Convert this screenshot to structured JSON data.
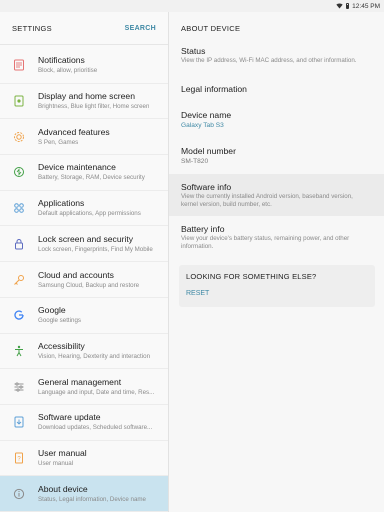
{
  "status_bar": {
    "time": "12:45 PM",
    "icons": [
      "wifi-icon",
      "battery-icon"
    ]
  },
  "left": {
    "header": {
      "title": "SETTINGS",
      "search_label": "SEARCH"
    },
    "items": [
      {
        "icon": "notifications-icon",
        "title": "Notifications",
        "subtitle": "Block, allow, prioritise",
        "color": "#e57373"
      },
      {
        "icon": "display-icon",
        "title": "Display and home screen",
        "subtitle": "Brightness, Blue light filter, Home screen",
        "color": "#7cb342"
      },
      {
        "icon": "advanced-features-icon",
        "title": "Advanced features",
        "subtitle": "S Pen, Games",
        "color": "#f0a24a"
      },
      {
        "icon": "device-maintenance-icon",
        "title": "Device maintenance",
        "subtitle": "Battery, Storage, RAM, Device security",
        "color": "#43a047"
      },
      {
        "icon": "applications-icon",
        "title": "Applications",
        "subtitle": "Default applications, App permissions",
        "color": "#5c9fd6"
      },
      {
        "icon": "lock-screen-icon",
        "title": "Lock screen and security",
        "subtitle": "Lock screen, Fingerprints, Find My Mobile",
        "color": "#5c6bc0"
      },
      {
        "icon": "cloud-accounts-icon",
        "title": "Cloud and accounts",
        "subtitle": "Samsung Cloud, Backup and restore",
        "color": "#f0a24a"
      },
      {
        "icon": "google-icon",
        "title": "Google",
        "subtitle": "Google settings",
        "color": "#4285f4"
      },
      {
        "icon": "accessibility-icon",
        "title": "Accessibility",
        "subtitle": "Vision, Hearing, Dexterity and interaction",
        "color": "#43a047"
      },
      {
        "icon": "general-management-icon",
        "title": "General management",
        "subtitle": "Language and input, Date and time, Res...",
        "color": "#8a8a8a"
      },
      {
        "icon": "software-update-icon",
        "title": "Software update",
        "subtitle": "Download updates, Scheduled software...",
        "color": "#5c9fd6"
      },
      {
        "icon": "user-manual-icon",
        "title": "User manual",
        "subtitle": "User manual",
        "color": "#f0a24a"
      },
      {
        "icon": "about-device-icon",
        "title": "About device",
        "subtitle": "Status, Legal information, Device name",
        "color": "#8a8a8a",
        "selected": true
      }
    ]
  },
  "right": {
    "header": {
      "title": "ABOUT DEVICE"
    },
    "items": [
      {
        "title": "Status",
        "subtitle": "View the IP address, Wi-Fi MAC address, and other information."
      },
      {
        "title": "Legal information"
      },
      {
        "title": "Device name",
        "value": "Galaxy Tab S3"
      },
      {
        "title": "Model number",
        "value_gray": "SM-T820"
      },
      {
        "title": "Software info",
        "subtitle_lines": [
          "View the currently installed Android version, baseband version,",
          "kernel version, build number, etc."
        ],
        "highlighted": true
      },
      {
        "title": "Battery info",
        "subtitle_lines": [
          "View your device's battery status, remaining power, and other",
          "information."
        ]
      }
    ],
    "looking_for": {
      "title": "LOOKING FOR SOMETHING ELSE?",
      "reset_label": "RESET"
    }
  }
}
